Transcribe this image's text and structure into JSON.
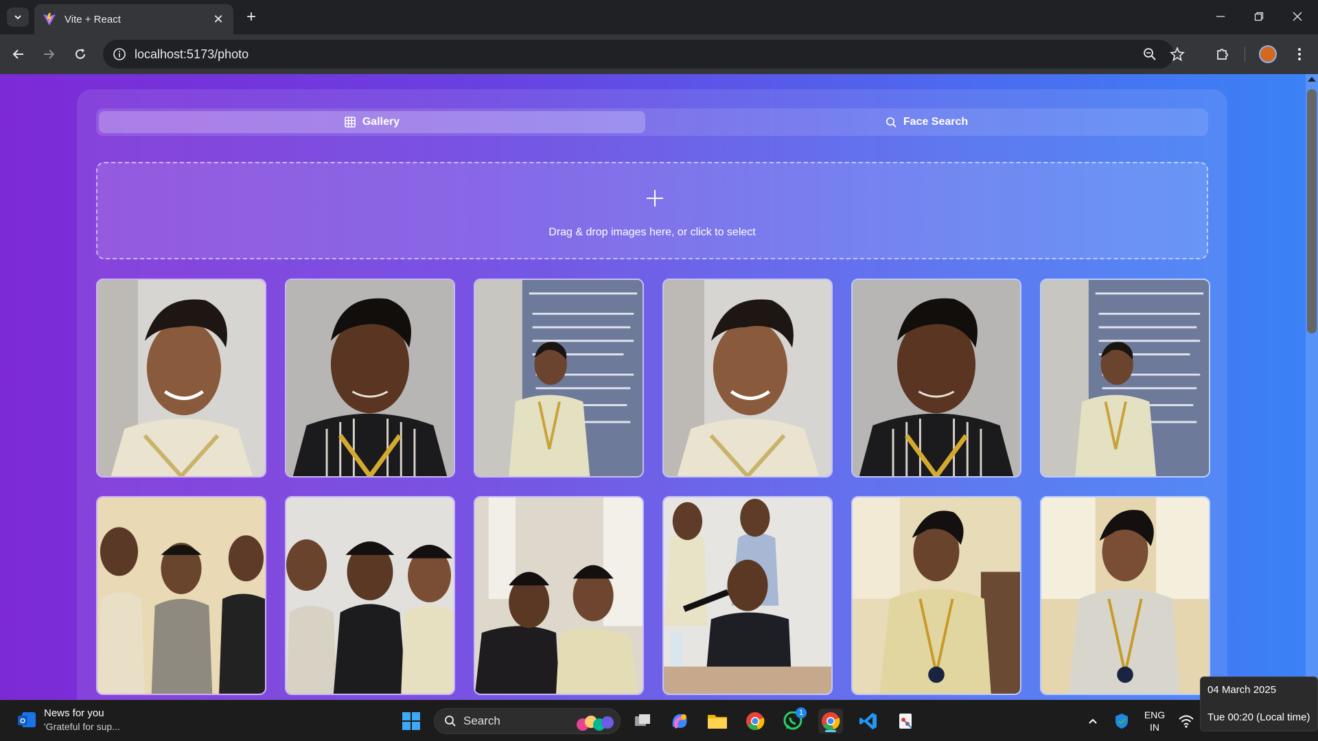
{
  "browser": {
    "tab_title": "Vite + React",
    "url": "localhost:5173/photo"
  },
  "app": {
    "tabs": [
      {
        "label": "Gallery",
        "icon": "grid-icon",
        "active": true
      },
      {
        "label": "Face Search",
        "icon": "search-icon",
        "active": false
      }
    ],
    "dropzone_text": "Drag & drop images here, or click to select",
    "photos": [
      {
        "subject": "portrait, striped shirt, white background"
      },
      {
        "subject": "portrait, dark striped shirt"
      },
      {
        "subject": "student presenting at college rules board"
      },
      {
        "subject": "portrait, striped shirt, white background"
      },
      {
        "subject": "portrait, dark striped shirt"
      },
      {
        "subject": "student presenting at college rules board"
      },
      {
        "subject": "group of three students"
      },
      {
        "subject": "group of students smiling"
      },
      {
        "subject": "group selfie of students"
      },
      {
        "subject": "student speaking into microphone at desk"
      },
      {
        "subject": "student in yellow striped shirt near window"
      },
      {
        "subject": "student in striped shirt near window"
      }
    ]
  },
  "taskbar": {
    "news_title": "News for you",
    "news_subtitle": "'Grateful for sup...",
    "search_label": "Search",
    "whatsapp_badge": "1",
    "lang_line1": "ENG",
    "lang_line2": "IN",
    "clock_date": "04 March 2025",
    "clock_time": "Tue 00:20 (Local time)"
  },
  "colors": {
    "page_gradient_start": "#7d2ad6",
    "page_gradient_end": "#3b82f6",
    "browser_bg": "#202124",
    "toolbar_bg": "#35363a"
  }
}
